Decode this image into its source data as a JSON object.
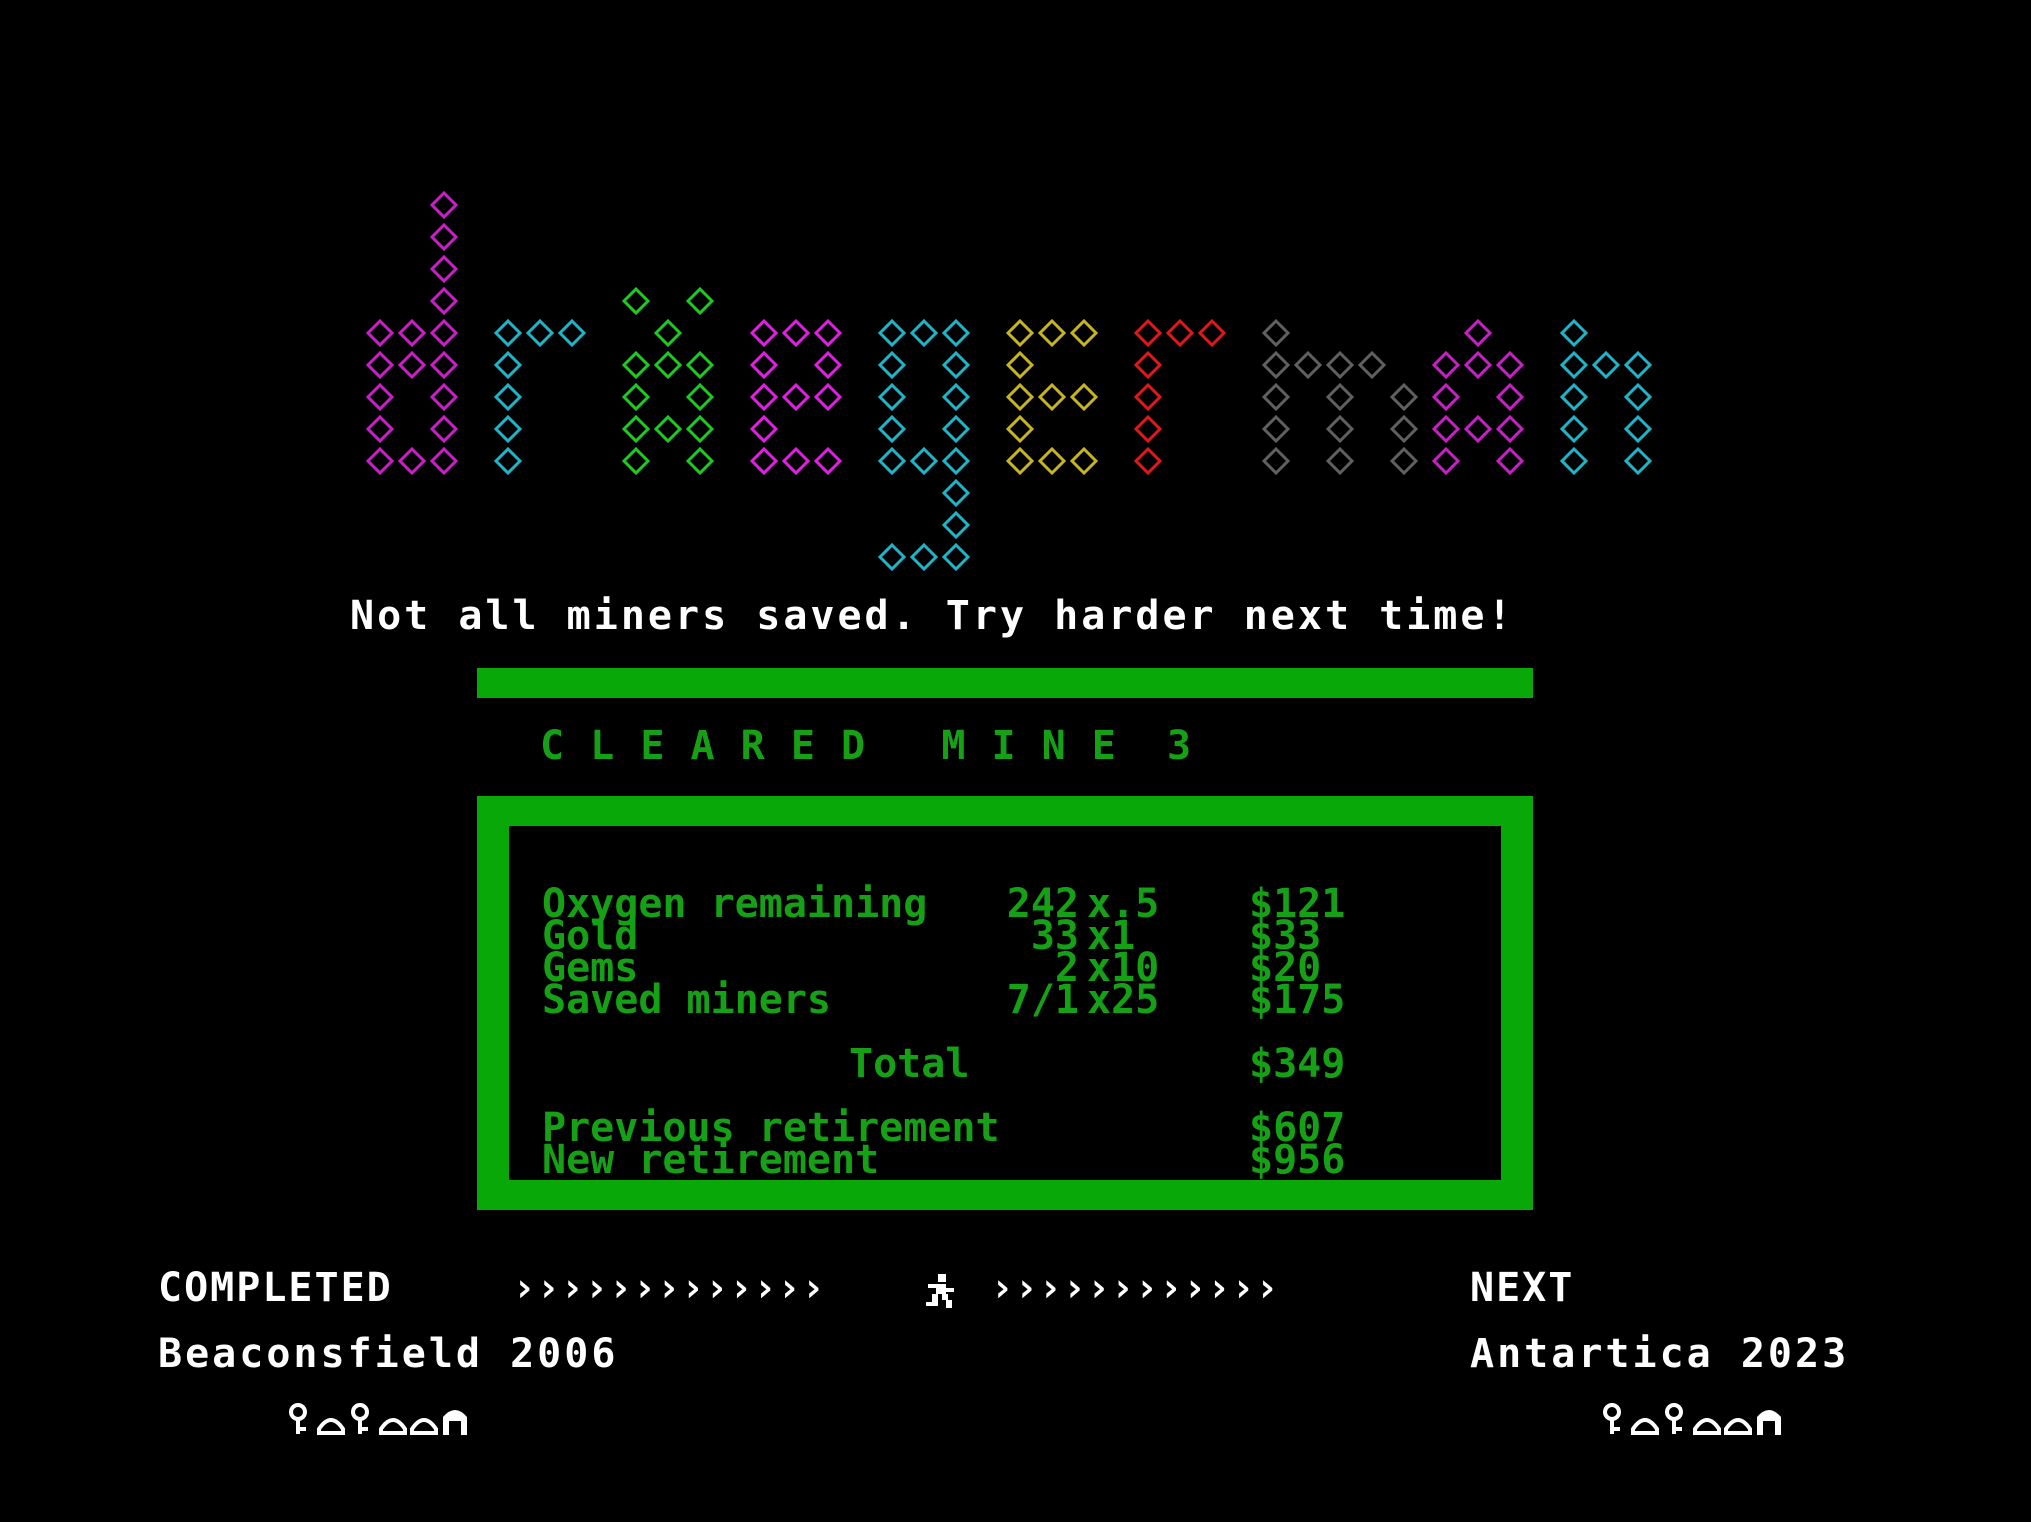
{
  "logo": {
    "letters": [
      {
        "char": "d",
        "color": "#c820c8"
      },
      {
        "char": "r",
        "color": "#20b4c8"
      },
      {
        "char": "i",
        "color": "#20c820"
      },
      {
        "char": "g",
        "color": "#e020e0"
      },
      {
        "char": "g",
        "color": "#20b4c8"
      },
      {
        "char": "e",
        "color": "#c8b420"
      },
      {
        "char": "r",
        "color": "#e01818"
      },
      {
        "char": "m",
        "color": "#606060"
      },
      {
        "char": "a",
        "color": "#c820c8"
      },
      {
        "char": "n",
        "color": "#20b4c8"
      }
    ]
  },
  "message": "Not all miners saved. Try harder next time!",
  "cleared_heading": "C L E A R E D   M I N E  3",
  "score": {
    "rows": [
      {
        "label": "Oxygen remaining",
        "qty": "242",
        "mult": "x.5",
        "amount": "$121"
      },
      {
        "label": "Gold",
        "qty": "33",
        "mult": "x1",
        "amount": "$33"
      },
      {
        "label": "Gems",
        "qty": "2",
        "mult": "x10",
        "amount": "$20"
      },
      {
        "label": "Saved miners",
        "qty": "7/1",
        "mult": "x25",
        "amount": "$175"
      }
    ],
    "total_label": "Total",
    "total_amount": "$349",
    "previous_label": "Previous retirement",
    "previous_amount": "$607",
    "new_label": "New retirement",
    "new_amount": "$956"
  },
  "footer": {
    "completed_label": "COMPLETED",
    "arrows_left": "›››››››››››››",
    "arrows_right": "››››››››››››",
    "next_label": "NEXT",
    "completed_mine": "Beaconsfield 2006",
    "next_mine": "Antartica 2023",
    "miner_icon": "running-miner-icon",
    "tile_icons": [
      "key-icon",
      "dome-icon",
      "key-icon",
      "dome-icon",
      "dome-icon",
      "arch-icon"
    ]
  },
  "colors": {
    "background": "#000000",
    "panel_green": "#08a808",
    "text_green": "#16a016",
    "text_white": "#ffffff"
  }
}
